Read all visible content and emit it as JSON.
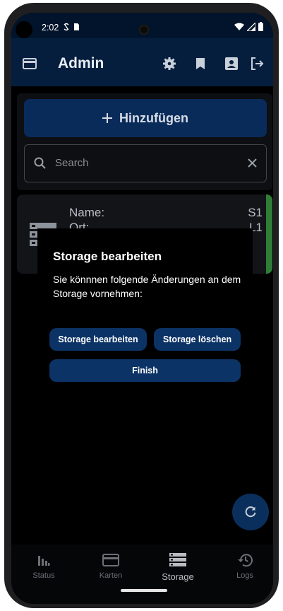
{
  "status_bar": {
    "time": "2:02",
    "indicators": [
      "vpn-icon",
      "sim-icon"
    ],
    "system_icons": [
      "wifi-icon",
      "signal-icon",
      "battery-icon"
    ]
  },
  "app_bar": {
    "title": "Admin",
    "icons": [
      "card-icon",
      "settings-icon",
      "bookmark-icon",
      "account-box-icon",
      "logout-icon"
    ]
  },
  "add_button": {
    "label": "Hinzufügen"
  },
  "search": {
    "placeholder": "Search"
  },
  "storage_card": {
    "labels": [
      "Name:",
      "Ort:"
    ],
    "values": [
      "S1",
      "L1"
    ],
    "accent_color": "#2f7d36"
  },
  "dialog": {
    "title": "Storage bearbeiten",
    "body": "Sie könnnen folgende Änderungen an dem Storage vornehmen:",
    "buttons": {
      "edit": "Storage bearbeiten",
      "delete": "Storage löschen",
      "finish": "Finish"
    }
  },
  "fab": {
    "icon": "refresh-icon"
  },
  "bottom_nav": [
    {
      "label": "Status",
      "icon": "status-icon",
      "active": false
    },
    {
      "label": "Karten",
      "icon": "cards-icon",
      "active": false
    },
    {
      "label": "Storage",
      "icon": "storage-icon",
      "active": true
    },
    {
      "label": "Logs",
      "icon": "history-icon",
      "active": false
    }
  ],
  "colors": {
    "app_bar": "#051e3e",
    "primary_button": "#0c3366",
    "accent_green": "#2f7d36"
  }
}
